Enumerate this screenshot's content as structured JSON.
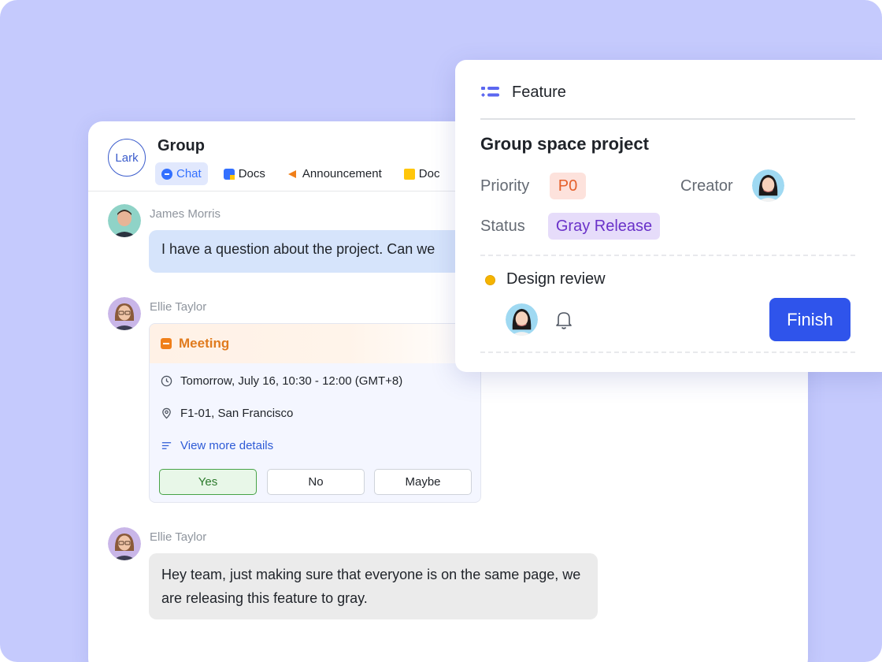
{
  "chat": {
    "logo_text": "Lark",
    "group_title": "Group",
    "tabs": [
      {
        "label": "Chat",
        "icon": "chat-icon"
      },
      {
        "label": "Docs",
        "icon": "docs-icon"
      },
      {
        "label": "Announcement",
        "icon": "announcement-icon"
      },
      {
        "label": "Doc",
        "icon": "folder-icon"
      }
    ],
    "messages": [
      {
        "sender": "James Morris",
        "text": "I have a question about the project. Can we"
      },
      {
        "sender": "Ellie Taylor"
      },
      {
        "sender": "Ellie Taylor",
        "text": "Hey team, just making sure that everyone is on the same page, we are releasing this feature to gray."
      }
    ],
    "meeting": {
      "title": "Meeting",
      "time": "Tomorrow, July 16, 10:30 - 12:00 (GMT+8)",
      "location": "F1-01, San Francisco",
      "details_link": "View more details",
      "rsvp": [
        "Yes",
        "No",
        "Maybe"
      ]
    }
  },
  "feature": {
    "header": "Feature",
    "title": "Group space project",
    "priority_label": "Priority",
    "priority_value": "P0",
    "creator_label": "Creator",
    "status_label": "Status",
    "status_value": "Gray Release",
    "task": "Design review",
    "finish_label": "Finish"
  },
  "colors": {
    "background": "#c5cafd",
    "accent_blue": "#2f54eb",
    "priority_bg": "#fde2dc",
    "status_bg": "#e6dcfa",
    "task_dot": "#f5b400"
  }
}
